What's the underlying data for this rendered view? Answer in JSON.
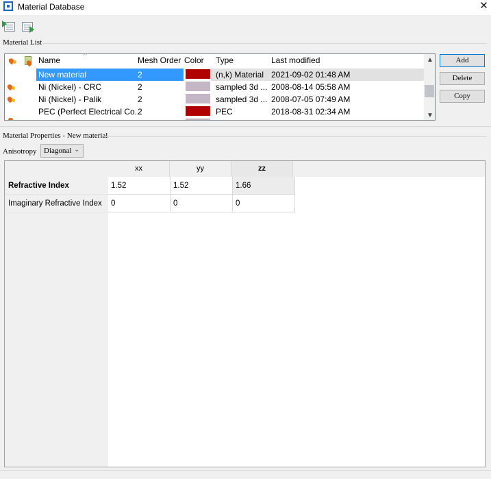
{
  "window": {
    "title": "Material Database",
    "close_glyph": "✕"
  },
  "toolbar": {
    "icons": [
      "import-icon",
      "export-icon"
    ]
  },
  "material_list": {
    "label": "Material List",
    "columns": [
      "Name",
      "Mesh Order",
      "Color",
      "Type",
      "Last modified"
    ],
    "rows": [
      {
        "name": "New material",
        "mesh_order": "2",
        "color": "#b00000",
        "type": "(n,k) Material",
        "modified": "2021-09-02 01:48 AM",
        "selected": true
      },
      {
        "name": "Ni (Nickel) - CRC",
        "mesh_order": "2",
        "color": "#c4b6c4",
        "type": "sampled 3d ...",
        "modified": "2008-08-14 05:58 AM",
        "icon": "flame-icon"
      },
      {
        "name": "Ni (Nickel) - Palik",
        "mesh_order": "2",
        "color": "#c4b6c4",
        "type": "sampled 3d ...",
        "modified": "2008-07-05 07:49 AM",
        "icon": "flame-icon"
      },
      {
        "name": "PEC (Perfect Electrical Co...",
        "mesh_order": "2",
        "color": "#b00000",
        "type": "PEC",
        "modified": "2018-08-31 02:34 AM"
      }
    ],
    "buttons": {
      "add": "Add",
      "delete": "Delete",
      "copy": "Copy"
    }
  },
  "properties": {
    "label": "Material Properties - New material",
    "anisotropy_label": "Anisotropy",
    "anisotropy_value": "Diagonal",
    "grid": {
      "columns": [
        "xx",
        "yy",
        "zz"
      ],
      "rows": [
        {
          "label": "Refractive Index",
          "values": [
            "1.52",
            "1.52",
            "1.66"
          ]
        },
        {
          "label": "Imaginary Refractive Index",
          "values": [
            "0",
            "0",
            "0"
          ]
        }
      ]
    }
  },
  "colors": {
    "selection": "#3399ff",
    "accent": "#0078d7"
  }
}
